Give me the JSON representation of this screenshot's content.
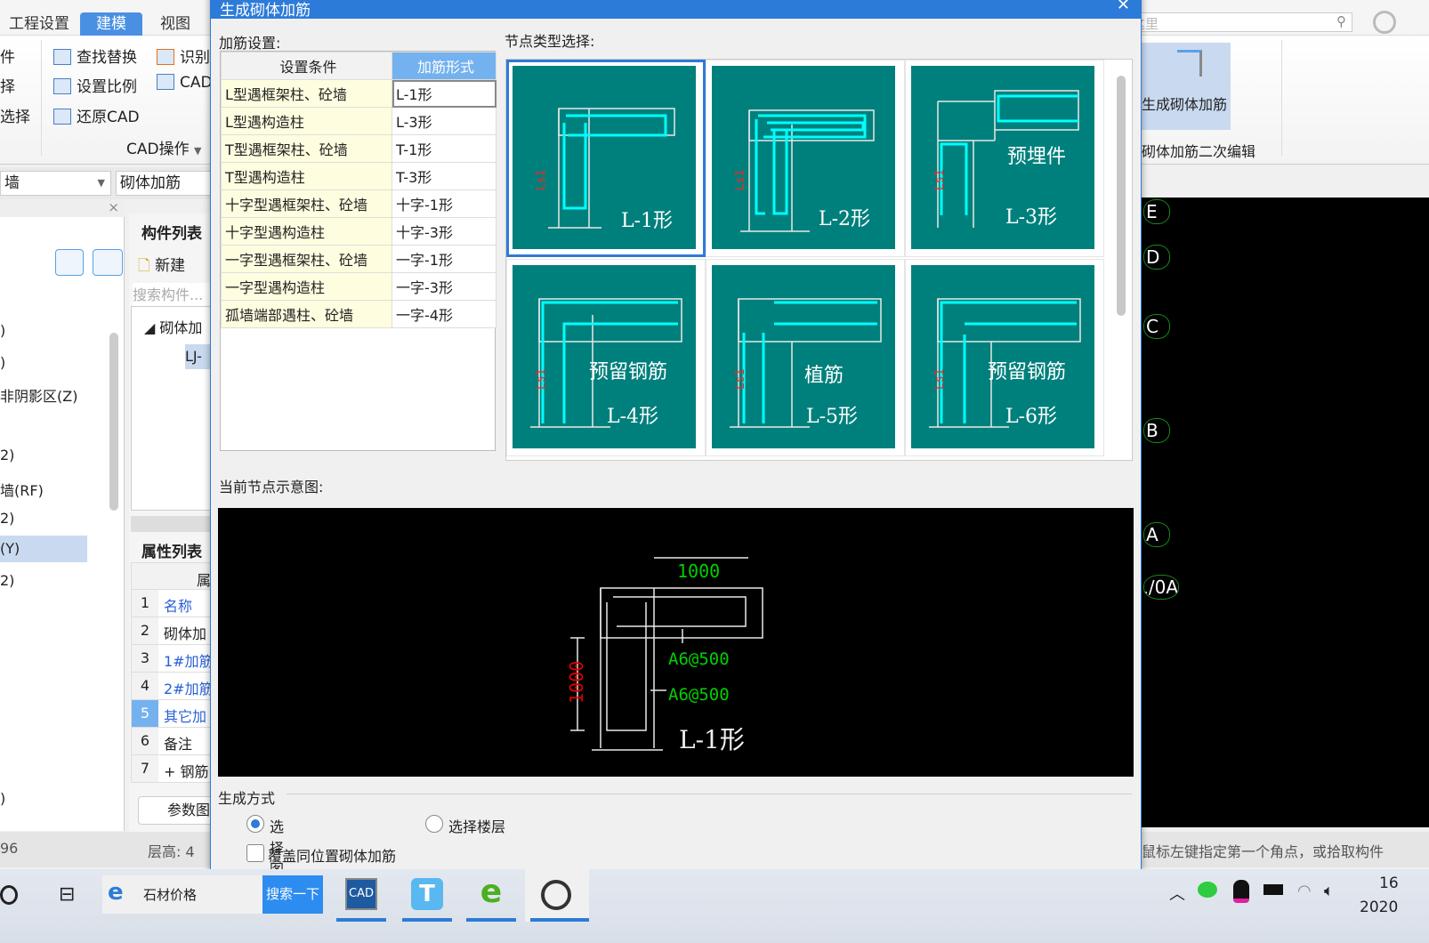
{
  "app": {
    "tabs": [
      {
        "label": "工程设置"
      },
      {
        "label": "建模",
        "active": true
      },
      {
        "label": "视图"
      }
    ],
    "ribbon": {
      "left_partial": [
        "件",
        "择",
        "选择"
      ],
      "items": [
        {
          "label": "查找替换",
          "icon": "find-replace-icon"
        },
        {
          "label": "设置比例",
          "icon": "set-scale-icon"
        },
        {
          "label": "还原CAD",
          "icon": "restore-cad-icon"
        },
        {
          "label": "识别",
          "icon": "identify-icon"
        },
        {
          "label": "CAD",
          "icon": "cad-icon"
        }
      ],
      "group_label": "CAD操作",
      "right_button": "生成砌体加筋",
      "right_group_label": "砌体加筋二次编辑",
      "search_placeholder": "这里"
    },
    "combo": {
      "left": "墙",
      "right": "砌体加筋"
    },
    "left_panel": {
      "items": [
        ")",
        ")",
        "非阴影区(Z)",
        "2)",
        "墙(RF)",
        "2)",
        "(Y)",
        "2)",
        ")"
      ],
      "selected_index": 6
    },
    "component_list": {
      "title": "构件列表",
      "new_label": "新建",
      "search_placeholder": "搜索构件...",
      "tree_root": "砌体加",
      "tree_child": "LJ-"
    },
    "property_list": {
      "title": "属性列表",
      "header": "属",
      "rows": [
        {
          "n": "1",
          "name": "名称",
          "blue": true
        },
        {
          "n": "2",
          "name": "砌体加",
          "blue": false
        },
        {
          "n": "3",
          "name": "1#加筋",
          "blue": true
        },
        {
          "n": "4",
          "name": "2#加筋",
          "blue": true
        },
        {
          "n": "5",
          "name": "其它加",
          "blue": true,
          "selected": true
        },
        {
          "n": "6",
          "name": "备注",
          "blue": false
        },
        {
          "n": "7",
          "name": "钢筋",
          "blue": false,
          "expand": "+"
        }
      ],
      "param_button": "参数图"
    },
    "status": {
      "left": "96",
      "floor_height": "层高:  4",
      "prompt": "鼠标左键指定第一个角点，或拾取构件"
    },
    "axes": [
      "E",
      "D",
      "C",
      "B",
      "A",
      "1/0A"
    ]
  },
  "dialog": {
    "title": "生成砌体加筋",
    "settings_label": "加筋设置:",
    "table_headers": [
      "设置条件",
      "加筋形式"
    ],
    "rows": [
      {
        "condition": "L型遇框架柱、砼墙",
        "form": "L-1形"
      },
      {
        "condition": "L型遇构造柱",
        "form": "L-3形"
      },
      {
        "condition": "T型遇框架柱、砼墙",
        "form": "T-1形"
      },
      {
        "condition": "T型遇构造柱",
        "form": "T-3形"
      },
      {
        "condition": "十字型遇框架柱、砼墙",
        "form": "十字-1形"
      },
      {
        "condition": "十字型遇构造柱",
        "form": "十字-3形"
      },
      {
        "condition": "一字型遇框架柱、砼墙",
        "form": "一字-1形"
      },
      {
        "condition": "一字型遇构造柱",
        "form": "一字-3形"
      },
      {
        "condition": "孤墙端部遇柱、砼墙",
        "form": "一字-4形"
      }
    ],
    "node_type_label": "节点类型选择:",
    "nodes": [
      {
        "name": "L-1形",
        "sub": "",
        "selected": true
      },
      {
        "name": "L-2形",
        "sub": ""
      },
      {
        "name": "L-3形",
        "sub": "预埋件"
      },
      {
        "name": "L-4形",
        "sub": "预留钢筋"
      },
      {
        "name": "L-5形",
        "sub": "植筋"
      },
      {
        "name": "L-6形",
        "sub": "预留钢筋"
      }
    ],
    "preview_label": "当前节点示意图:",
    "preview": {
      "dim_h": "1000",
      "dim_v": "1000",
      "rebar1": "A6@500",
      "rebar2": "A6@500",
      "shape": "L-1形"
    },
    "gen_label": "生成方式",
    "radio_options": [
      {
        "label": "选择图元",
        "checked": true
      },
      {
        "label": "选择楼层",
        "checked": false
      }
    ],
    "overwrite_label": "覆盖同位置砌体加筋",
    "overwrite_checked": false
  },
  "taskbar": {
    "search_text": "石材价格",
    "search_button": "搜索一下",
    "apps": [
      "CAD",
      "T",
      "e",
      "photo"
    ],
    "clock_time": "16",
    "clock_date": "2020"
  }
}
